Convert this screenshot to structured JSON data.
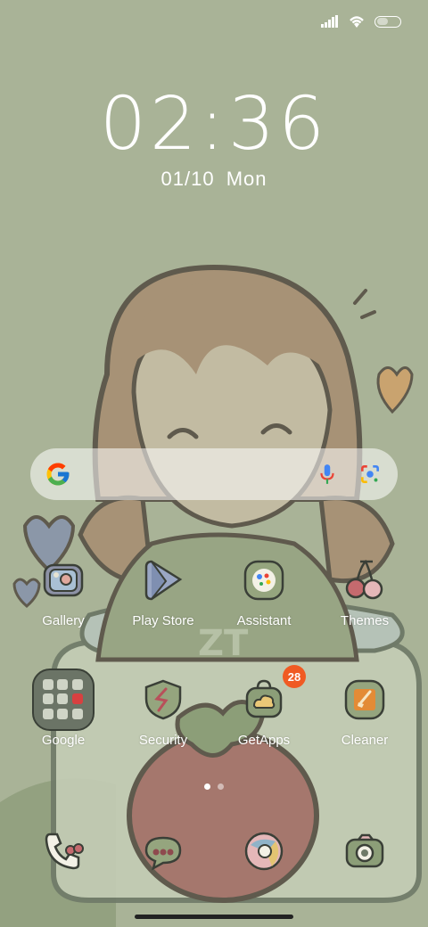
{
  "status": {
    "icons": [
      "signal-icon",
      "wifi-icon",
      "battery-icon"
    ]
  },
  "clock": {
    "time": "02:36",
    "date": "01/10",
    "weekday": "Mon"
  },
  "search": {
    "icons": [
      "google-logo-icon",
      "mic-icon",
      "lens-icon"
    ]
  },
  "apps": {
    "row1": [
      {
        "label": "Gallery"
      },
      {
        "label": "Play Store"
      },
      {
        "label": "Assistant"
      },
      {
        "label": "Themes"
      }
    ],
    "row2": [
      {
        "label": "Google"
      },
      {
        "label": "Security"
      },
      {
        "label": "GetApps",
        "badge": "28"
      },
      {
        "label": "Cleaner"
      }
    ]
  },
  "dock": {
    "icons": [
      "phone-icon",
      "messages-icon",
      "browser-icon",
      "camera-icon"
    ]
  },
  "pages": {
    "count": 2,
    "active": 1
  },
  "colors": {
    "wallpaper": "#a9b397",
    "badge": "#f05a23"
  }
}
